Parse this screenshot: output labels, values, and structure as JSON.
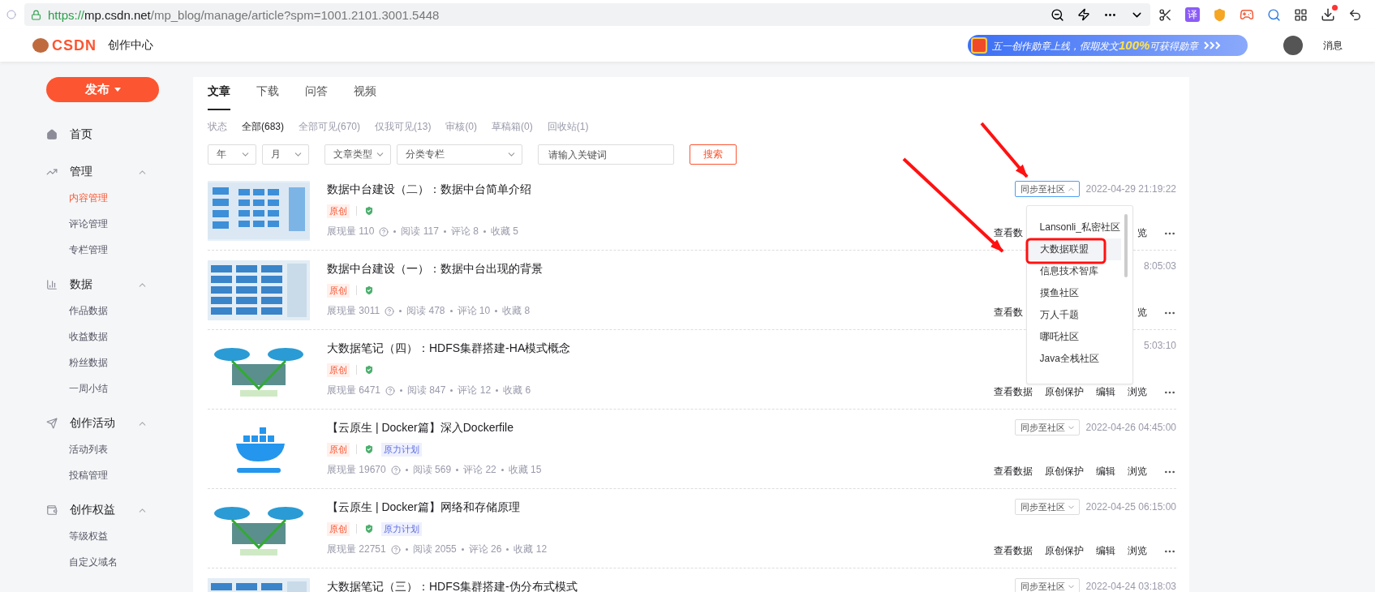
{
  "browser": {
    "url": {
      "scheme": "https://",
      "host": "mp.csdn.net",
      "path": "/mp_blog/manage/article?spm=1001.2101.3001.5448"
    },
    "translate_label": "译"
  },
  "header": {
    "logo": "CSDN",
    "title": "创作中心",
    "banner": "五一创作勋章上线，假期发文**100%**可获得勋章",
    "messages": "消息"
  },
  "sidebar": {
    "publish": "发布",
    "home": "首页",
    "groups": [
      {
        "label": "管理",
        "expanded": true,
        "children": [
          {
            "label": "内容管理",
            "selected": true
          },
          {
            "label": "评论管理",
            "selected": false
          },
          {
            "label": "专栏管理",
            "selected": false
          }
        ]
      },
      {
        "label": "数据",
        "expanded": true,
        "children": [
          {
            "label": "作品数据",
            "selected": false
          },
          {
            "label": "收益数据",
            "selected": false
          },
          {
            "label": "粉丝数据",
            "selected": false
          },
          {
            "label": "一周小结",
            "selected": false
          }
        ]
      },
      {
        "label": "创作活动",
        "expanded": true,
        "children": [
          {
            "label": "活动列表",
            "selected": false
          },
          {
            "label": "投稿管理",
            "selected": false
          }
        ]
      },
      {
        "label": "创作权益",
        "expanded": true,
        "children": [
          {
            "label": "等级权益",
            "selected": false
          },
          {
            "label": "自定义域名",
            "selected": false
          }
        ]
      }
    ]
  },
  "content": {
    "tabs": [
      {
        "label": "文章",
        "selected": true
      },
      {
        "label": "下载",
        "selected": false
      },
      {
        "label": "问答",
        "selected": false
      },
      {
        "label": "视频",
        "selected": false
      }
    ],
    "status": {
      "label": "状态",
      "options": [
        {
          "label": "全部(683)",
          "selected": true
        },
        {
          "label": "全部可见(670)",
          "selected": false
        },
        {
          "label": "仅我可见(13)",
          "selected": false
        },
        {
          "label": "审核(0)",
          "selected": false
        },
        {
          "label": "草稿箱(0)",
          "selected": false
        },
        {
          "label": "回收站(1)",
          "selected": false
        }
      ]
    },
    "filters": {
      "selects": [
        "年",
        "月",
        "文章类型",
        "分类专栏"
      ],
      "search_placeholder": "请输入关键词",
      "search_button": "搜索"
    },
    "articles": [
      {
        "kind": "diagram",
        "title": "数据中台建设（二）：数据中台简单介绍",
        "tags": [
          {
            "kind": "original",
            "label": "原创"
          },
          {
            "kind": "shield"
          }
        ],
        "stats": [
          "展现量 110",
          "阅读 117",
          "评论 8",
          "收藏 5"
        ],
        "sync": {
          "label": "同步至社区",
          "expanded": true
        },
        "date": "2022-04-29 21:19:22",
        "actions": [
          "查看数",
          "览"
        ]
      },
      {
        "kind": "columns",
        "title": "数据中台建设（一）：数据中台出现的背景",
        "tags": [
          {
            "kind": "original",
            "label": "原创"
          },
          {
            "kind": "shield"
          }
        ],
        "stats": [
          "展现量 3011",
          "阅读 478",
          "评论 10",
          "收藏 8"
        ],
        "date": "8:05:03",
        "actions": [
          "查看数",
          "览"
        ]
      },
      {
        "kind": "network",
        "title": "大数据笔记（四）：HDFS集群搭建-HA模式概念",
        "tags": [
          {
            "kind": "original",
            "label": "原创"
          },
          {
            "kind": "shield"
          }
        ],
        "stats": [
          "展现量 6471",
          "阅读 847",
          "评论 12",
          "收藏 6"
        ],
        "date": "5:03:10",
        "actions": [
          "查看数据",
          "原创保护",
          "编辑",
          "浏览"
        ]
      },
      {
        "kind": "whale",
        "title": "【云原生 | Docker篇】深入Dockerfile",
        "tags": [
          {
            "kind": "original",
            "label": "原创"
          },
          {
            "kind": "shield"
          },
          {
            "kind": "plan",
            "label": "原力计划"
          }
        ],
        "stats": [
          "展现量 19670",
          "阅读 569",
          "评论 22",
          "收藏 15"
        ],
        "sync": {
          "label": "同步至社区",
          "expanded": false
        },
        "date": "2022-04-26 04:45:00",
        "actions": [
          "查看数据",
          "原创保护",
          "编辑",
          "浏览"
        ]
      },
      {
        "kind": "network",
        "title": "【云原生 | Docker篇】网络和存储原理",
        "tags": [
          {
            "kind": "original",
            "label": "原创"
          },
          {
            "kind": "shield"
          },
          {
            "kind": "plan",
            "label": "原力计划"
          }
        ],
        "stats": [
          "展现量 22751",
          "阅读 2055",
          "评论 26",
          "收藏 12"
        ],
        "sync": {
          "label": "同步至社区",
          "expanded": false
        },
        "date": "2022-04-25 06:15:00",
        "actions": [
          "查看数据",
          "原创保护",
          "编辑",
          "浏览"
        ]
      },
      {
        "kind": "columns",
        "title": "大数据笔记（三）：HDFS集群搭建-伪分布式模式",
        "sync": {
          "label": "同步至社区",
          "expanded": false
        },
        "date": "2022-04-24 03:18:03"
      }
    ],
    "sync_menu": [
      {
        "label": "Lansonli_私密社区",
        "selected": false
      },
      {
        "label": "大数据联盟",
        "selected": true
      },
      {
        "label": "信息技术智库",
        "selected": false
      },
      {
        "label": "摸鱼社区",
        "selected": false
      },
      {
        "label": "万人千题",
        "selected": false
      },
      {
        "label": "哪吒社区",
        "selected": false
      },
      {
        "label": "Java全栈社区",
        "selected": false
      }
    ]
  }
}
